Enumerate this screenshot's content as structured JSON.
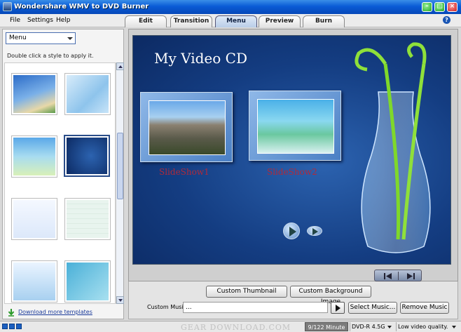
{
  "window": {
    "title": "Wondershare WMV to DVD Burner"
  },
  "menubar": {
    "items": [
      "File",
      "Settings",
      "Help"
    ]
  },
  "tabs": [
    {
      "label": "Edit"
    },
    {
      "label": "Transition"
    },
    {
      "label": "Menu",
      "active": true
    },
    {
      "label": "Preview"
    },
    {
      "label": "Burn"
    }
  ],
  "left_panel": {
    "template_selector": "Menu",
    "hint": "Double click a style to apply it.",
    "download_link": "Download more templates"
  },
  "preview": {
    "title": "My Video CD",
    "slideshows": [
      "SlideShow1",
      "SlideShow2"
    ]
  },
  "controls": {
    "custom_thumbnail": "Custom Thumbnail",
    "custom_background": "Custom Background Image",
    "custom_music_label": "Custom Music :",
    "custom_music_value": "...",
    "select_music": "Select Music...",
    "remove_music": "Remove Music"
  },
  "statusbar": {
    "watermark": "GEAR DOWNLOAD.COM",
    "minutes": "9/122 Minute",
    "disc": "DVD-R 4.5G",
    "quality": "Low video quality."
  },
  "colors": {
    "titlebar": "#0a5bd6",
    "preview_bg": "#1a4a94",
    "slideshow_text": "#b02a3a"
  }
}
